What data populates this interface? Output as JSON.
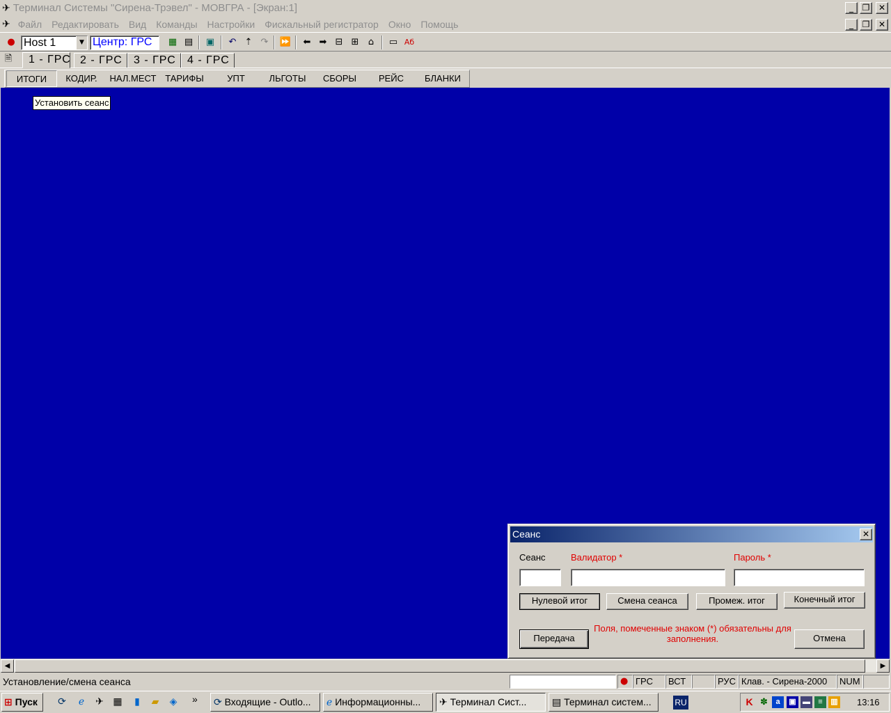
{
  "window": {
    "title": "Терминал Системы \"Сирена-Трэвел\" - МОВГРА - [Экран:1]",
    "controls": {
      "minimize": "_",
      "restore": "❐",
      "close": "✕"
    }
  },
  "menu": [
    "Файл",
    "Редактировать",
    "Вид",
    "Команды",
    "Настройки",
    "Фискальный регистратор",
    "Окно",
    "Помощь"
  ],
  "toolbar": {
    "host_select": "Host 1",
    "center_label": "Центр: ГРС"
  },
  "host_tabs": [
    "1 - ГРС",
    "2 - ГРС",
    "3 - ГРС",
    "4 - ГРС"
  ],
  "function_tabs": [
    "ИТОГИ",
    "КОДИР.",
    "НАЛ.МЕСТ",
    "ТАРИФЫ",
    "УПТ",
    "ЛЬГОТЫ",
    "СБОРЫ",
    "РЕЙС",
    "БЛАНКИ"
  ],
  "tooltip": "Установить сеанс",
  "dialog": {
    "title": "Сеанс",
    "close": "✕",
    "session_label": "Сеанс",
    "validator_label": "Валидатор *",
    "password_label": "Пароль *",
    "session_value": "",
    "validator_value": "",
    "password_value": "",
    "buttons": {
      "zero_total": "Нулевой итог",
      "change_session": "Смена сеанса",
      "interim_total": "Промеж. итог",
      "final_total": "Конечный итог",
      "transmit": "Передача",
      "cancel": "Отмена"
    },
    "note": "Поля, помеченные знаком (*) обязательны для заполнения."
  },
  "statusbar": {
    "message": "Установление/смена сеанса",
    "field": "",
    "grs": "ГРС",
    "vst": "ВСТ",
    "lang": "РУС",
    "keyboard": "Клав. - Сирена-2000",
    "num": "NUM"
  },
  "taskbar": {
    "start": "Пуск",
    "chevron": "»",
    "tasks": [
      "Входящие - Outlo...",
      "Информационны...",
      "Терминал Сист...",
      "Терминал систем..."
    ],
    "lang_indicator": "RU",
    "clock": "13:16"
  },
  "colors": {
    "workarea": "#0000a8",
    "dialog_title_start": "#0a246a",
    "dialog_title_end": "#a6caf0",
    "required": "#e00000",
    "center_label": "#0000ff"
  }
}
